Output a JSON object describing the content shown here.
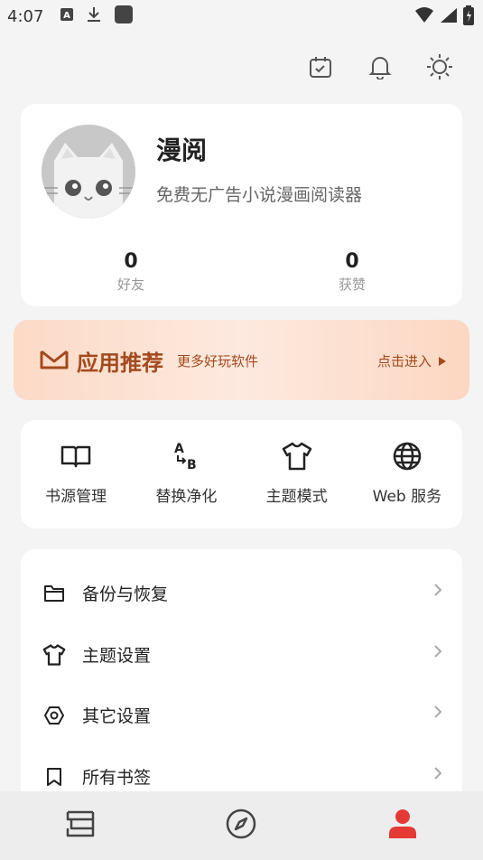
{
  "status_bar": {
    "time": "4:07",
    "icons": [
      "a-box-icon",
      "download-icon",
      "square-icon"
    ],
    "right_icons": [
      "wifi-icon",
      "signal-icon",
      "battery-icon"
    ]
  },
  "top_actions": [
    "calendar-check-icon",
    "bell-icon",
    "brightness-icon"
  ],
  "profile": {
    "name": "漫阅",
    "description": "免费无广告小说漫画阅读器",
    "stats": [
      {
        "value": "0",
        "label": "好友"
      },
      {
        "value": "0",
        "label": "获赞"
      }
    ]
  },
  "promo": {
    "title": "应用推荐",
    "subtitle": "更多好玩软件",
    "enter": "点击进入",
    "accent": "#a34a1e"
  },
  "tools": [
    {
      "label": "书源管理",
      "icon": "book-open-icon"
    },
    {
      "label": "替换净化",
      "icon": "a-to-b-icon"
    },
    {
      "label": "主题模式",
      "icon": "tshirt-icon"
    },
    {
      "label": "Web 服务",
      "icon": "globe-icon"
    }
  ],
  "settings": [
    {
      "label": "备份与恢复",
      "icon": "folder-icon"
    },
    {
      "label": "主题设置",
      "icon": "tshirt-icon"
    },
    {
      "label": "其它设置",
      "icon": "hexagon-settings-icon"
    },
    {
      "label": "所有书签",
      "icon": "bookmark-icon"
    }
  ],
  "bottom_nav": [
    {
      "name": "bookshelf",
      "icon": "stack-icon"
    },
    {
      "name": "discover",
      "icon": "compass-icon"
    },
    {
      "name": "profile",
      "icon": "person-icon",
      "active": true
    }
  ],
  "colors": {
    "active": "#e53935",
    "background": "#f4f4f4"
  }
}
